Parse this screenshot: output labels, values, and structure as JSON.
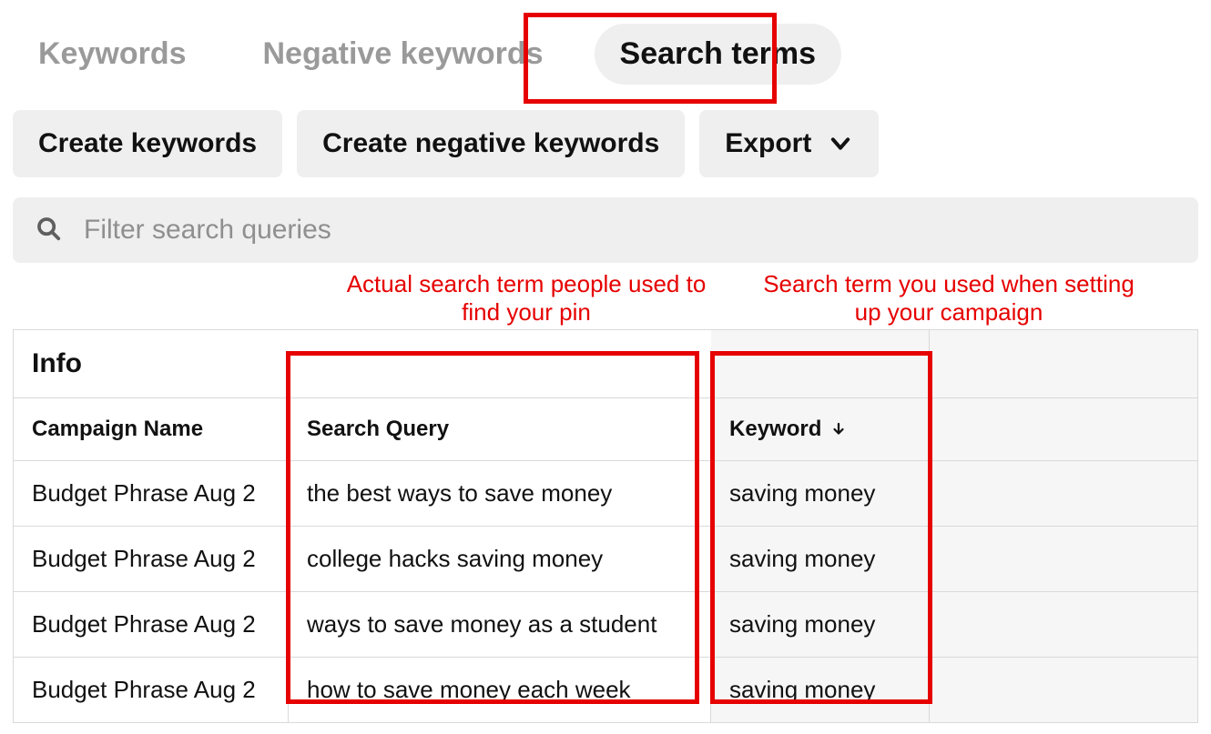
{
  "tabs": {
    "keywords": "Keywords",
    "negative": "Negative keywords",
    "search_terms": "Search terms"
  },
  "toolbar": {
    "create_keywords": "Create keywords",
    "create_negative": "Create negative keywords",
    "export": "Export"
  },
  "filter": {
    "placeholder": "Filter search queries"
  },
  "annotations": {
    "search_query": "Actual search term people used to find your pin",
    "keyword": "Search term you used when setting up your campaign"
  },
  "table": {
    "info_header": "Info",
    "columns": {
      "campaign": "Campaign Name",
      "search_query": "Search Query",
      "keyword": "Keyword"
    },
    "rows": [
      {
        "campaign": "Budget Phrase Aug 2",
        "query": "the best ways to save money",
        "keyword": "saving money"
      },
      {
        "campaign": "Budget Phrase Aug 2",
        "query": "college hacks saving money",
        "keyword": "saving money"
      },
      {
        "campaign": "Budget Phrase Aug 2",
        "query": "ways to save money as a student",
        "keyword": "saving money"
      },
      {
        "campaign": "Budget Phrase Aug 2",
        "query": "how to save money each week",
        "keyword": "saving money"
      }
    ]
  }
}
